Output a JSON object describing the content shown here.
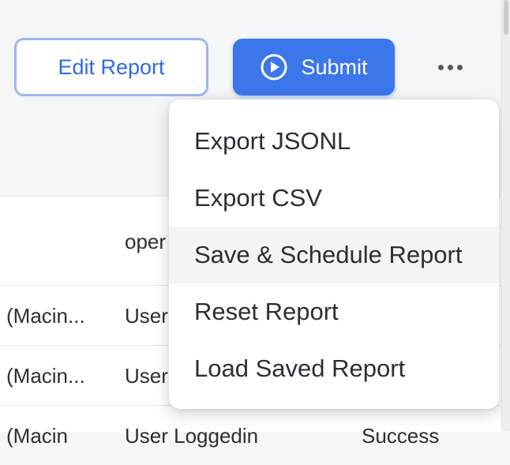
{
  "header": {
    "edit_report_label": "Edit Report",
    "submit_label": "Submit",
    "submit_icon": "play-circle-icon",
    "more_icon": "more-horizontal-icon"
  },
  "table": {
    "header_cells": [
      "oper"
    ],
    "rows": [
      {
        "col1": "(Macin...",
        "col2": "User"
      },
      {
        "col1": "(Macin...",
        "col2": "User"
      },
      {
        "col1": "(Macin",
        "col2": "User Loggedin",
        "col3": "Success"
      }
    ]
  },
  "menu": {
    "items": [
      {
        "label": "Export JSONL"
      },
      {
        "label": "Export CSV"
      },
      {
        "label": "Save & Schedule Report",
        "hovered": true
      },
      {
        "label": "Reset Report"
      },
      {
        "label": "Load Saved Report"
      }
    ]
  },
  "colors": {
    "primary": "#3b76ea",
    "primary_text": "#2f6adf",
    "outline": "#9db6f0"
  }
}
